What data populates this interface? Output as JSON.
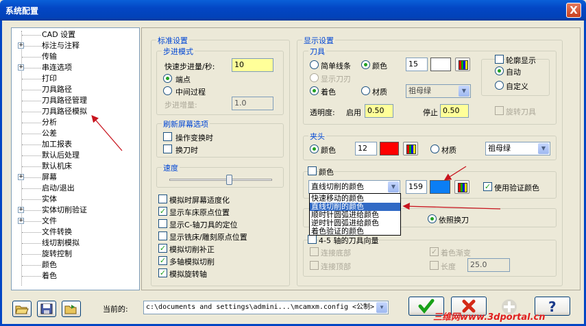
{
  "window": {
    "title": "系统配置",
    "close": "X"
  },
  "tree": {
    "items": [
      {
        "label": "CAD 设置",
        "expandable": false
      },
      {
        "label": "标注与注释",
        "expandable": true
      },
      {
        "label": "传输",
        "expandable": false
      },
      {
        "label": "串连选项",
        "expandable": true
      },
      {
        "label": "打印",
        "expandable": false
      },
      {
        "label": "刀具路径",
        "expandable": false
      },
      {
        "label": "刀具路径管理",
        "expandable": false
      },
      {
        "label": "刀具路径模拟",
        "expandable": false
      },
      {
        "label": "分析",
        "expandable": false
      },
      {
        "label": "公差",
        "expandable": false
      },
      {
        "label": "加工报表",
        "expandable": false
      },
      {
        "label": "默认后处理",
        "expandable": false
      },
      {
        "label": "默认机床",
        "expandable": false
      },
      {
        "label": "屏幕",
        "expandable": true
      },
      {
        "label": "启动/退出",
        "expandable": false
      },
      {
        "label": "实体",
        "expandable": false
      },
      {
        "label": "实体切削验证",
        "expandable": true
      },
      {
        "label": "文件",
        "expandable": true
      },
      {
        "label": "文件转换",
        "expandable": false
      },
      {
        "label": "线切割模拟",
        "expandable": false
      },
      {
        "label": "旋转控制",
        "expandable": false
      },
      {
        "label": "颜色",
        "expandable": false
      },
      {
        "label": "着色",
        "expandable": false
      }
    ]
  },
  "std": {
    "title": "标准设置",
    "step": {
      "title": "步进模式",
      "fast_label": "快速步进量/秒:",
      "fast_value": "10",
      "endpoint": "端点",
      "midprocess": "中间过程",
      "step_inc_label": "步进增量:",
      "step_inc_value": "1.0"
    },
    "refresh": {
      "title": "刷新屏幕选项",
      "on_op_change": "操作变换时",
      "on_tool_change": "换刀时"
    },
    "speed": {
      "title": "速度",
      "value_pct": 58
    },
    "checks": [
      {
        "label": "模拟时屏幕适度化",
        "checked": false
      },
      {
        "label": "显示车床原点位置",
        "checked": true
      },
      {
        "label": "显示C-轴刀具的定位",
        "checked": false
      },
      {
        "label": "显示铣床/雕刻原点位置",
        "checked": false
      },
      {
        "label": "模拟切削补正",
        "checked": true
      },
      {
        "label": "多轴模拟切削",
        "checked": true
      },
      {
        "label": "模拟旋转轴",
        "checked": true
      }
    ]
  },
  "disp": {
    "title": "显示设置",
    "tool": {
      "title": "刀具",
      "simple_line": "简单线条",
      "color": "颜色",
      "color_value": "15",
      "show_tool": "显示刀刃",
      "shade": "着色",
      "material": "材质",
      "material_value": "祖母绿",
      "transparency": "透明度:",
      "enable": "启用",
      "enable_value": "0.50",
      "stop": "停止",
      "stop_value": "0.50"
    },
    "outline": {
      "title": "轮廓显示",
      "auto": "自动",
      "custom": "自定义",
      "rotate_tool": "旋转刀具"
    },
    "holder": {
      "title": "夹头",
      "color": "颜色",
      "color_value": "12",
      "material": "材质",
      "material_value": "祖母绿"
    },
    "colors": {
      "title": "颜色",
      "select_value": "直线切削的颜色",
      "value": "159",
      "use_verify": "使用验证颜色",
      "options": [
        "快速移动的颜色",
        "直线切削的颜色",
        "顺时针圆弧进给颜色",
        "逆时针圆弧进给颜色",
        "着色验证的颜色"
      ],
      "tool_change": "依照换刀"
    },
    "axis45": {
      "title": "4-5 轴的刀具向量",
      "connect_bottom": "连接底部",
      "connect_top": "连接顶部",
      "shade_gradient": "着色渐变",
      "length": "长度",
      "length_value": "25.0"
    }
  },
  "bottom": {
    "current_label": "当前的:",
    "path": "c:\\documents and settings\\admini...\\mcamxm.config <公制>"
  },
  "colors": {
    "red_swatch": "#ff0000",
    "blue_swatch": "#0b7ef5",
    "arrow": "#c8141e",
    "titlebar": "#0346c4"
  },
  "watermark": "三维网www.3dportal.cn"
}
